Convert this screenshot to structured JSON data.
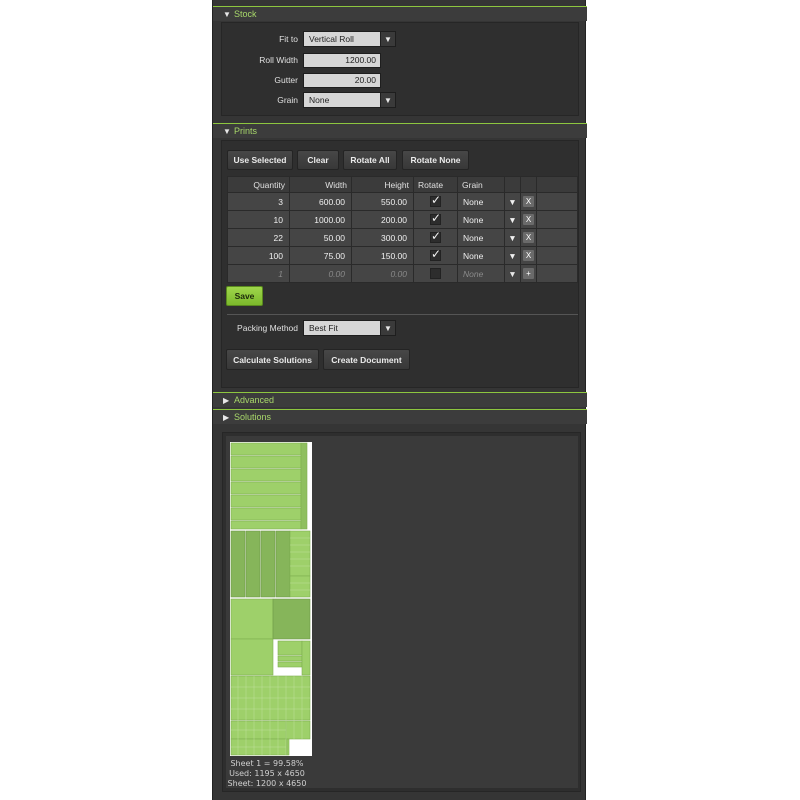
{
  "colors": {
    "accent": "#8dc63f",
    "panel": "#353535",
    "piece": "#9ed06a"
  },
  "stock": {
    "title": "Stock",
    "fit_label": "Fit to",
    "fit_value": "Vertical Roll",
    "roll_width_label": "Roll Width",
    "roll_width_value": "1200.00",
    "gutter_label": "Gutter",
    "gutter_value": "20.00",
    "grain_label": "Grain",
    "grain_value": "None"
  },
  "prints": {
    "title": "Prints",
    "buttons": {
      "use_selected": "Use Selected",
      "clear": "Clear",
      "rotate_all": "Rotate All",
      "rotate_none": "Rotate None"
    },
    "columns": [
      "Quantity",
      "Width",
      "Height",
      "Rotate",
      "Grain"
    ],
    "rows": [
      {
        "quantity": "3",
        "width": "600.00",
        "height": "550.00",
        "rotate": true,
        "grain": "None"
      },
      {
        "quantity": "10",
        "width": "1000.00",
        "height": "200.00",
        "rotate": true,
        "grain": "None"
      },
      {
        "quantity": "22",
        "width": "50.00",
        "height": "300.00",
        "rotate": true,
        "grain": "None"
      },
      {
        "quantity": "100",
        "width": "75.00",
        "height": "150.00",
        "rotate": true,
        "grain": "None"
      }
    ],
    "new_row": {
      "quantity": "1",
      "width": "0.00",
      "height": "0.00",
      "rotate": false,
      "grain": "None"
    },
    "save_label": "Save",
    "packing_label": "Packing Method",
    "packing_value": "Best Fit",
    "calc_label": "Calculate Solutions",
    "create_label": "Create Document"
  },
  "advanced": {
    "title": "Advanced"
  },
  "solutions": {
    "title": "Solutions",
    "sheet_line1": "Sheet 1 = 99.58%",
    "sheet_line2": "Used: 1195 x 4650",
    "sheet_line3": "Sheet: 1200 x 4650"
  },
  "icons": {
    "expanded": "triangle-down-icon",
    "collapsed": "triangle-right-icon",
    "dropdown": "chevron-down-icon",
    "delete": "close-icon",
    "add": "plus-icon",
    "check": "check-icon"
  }
}
